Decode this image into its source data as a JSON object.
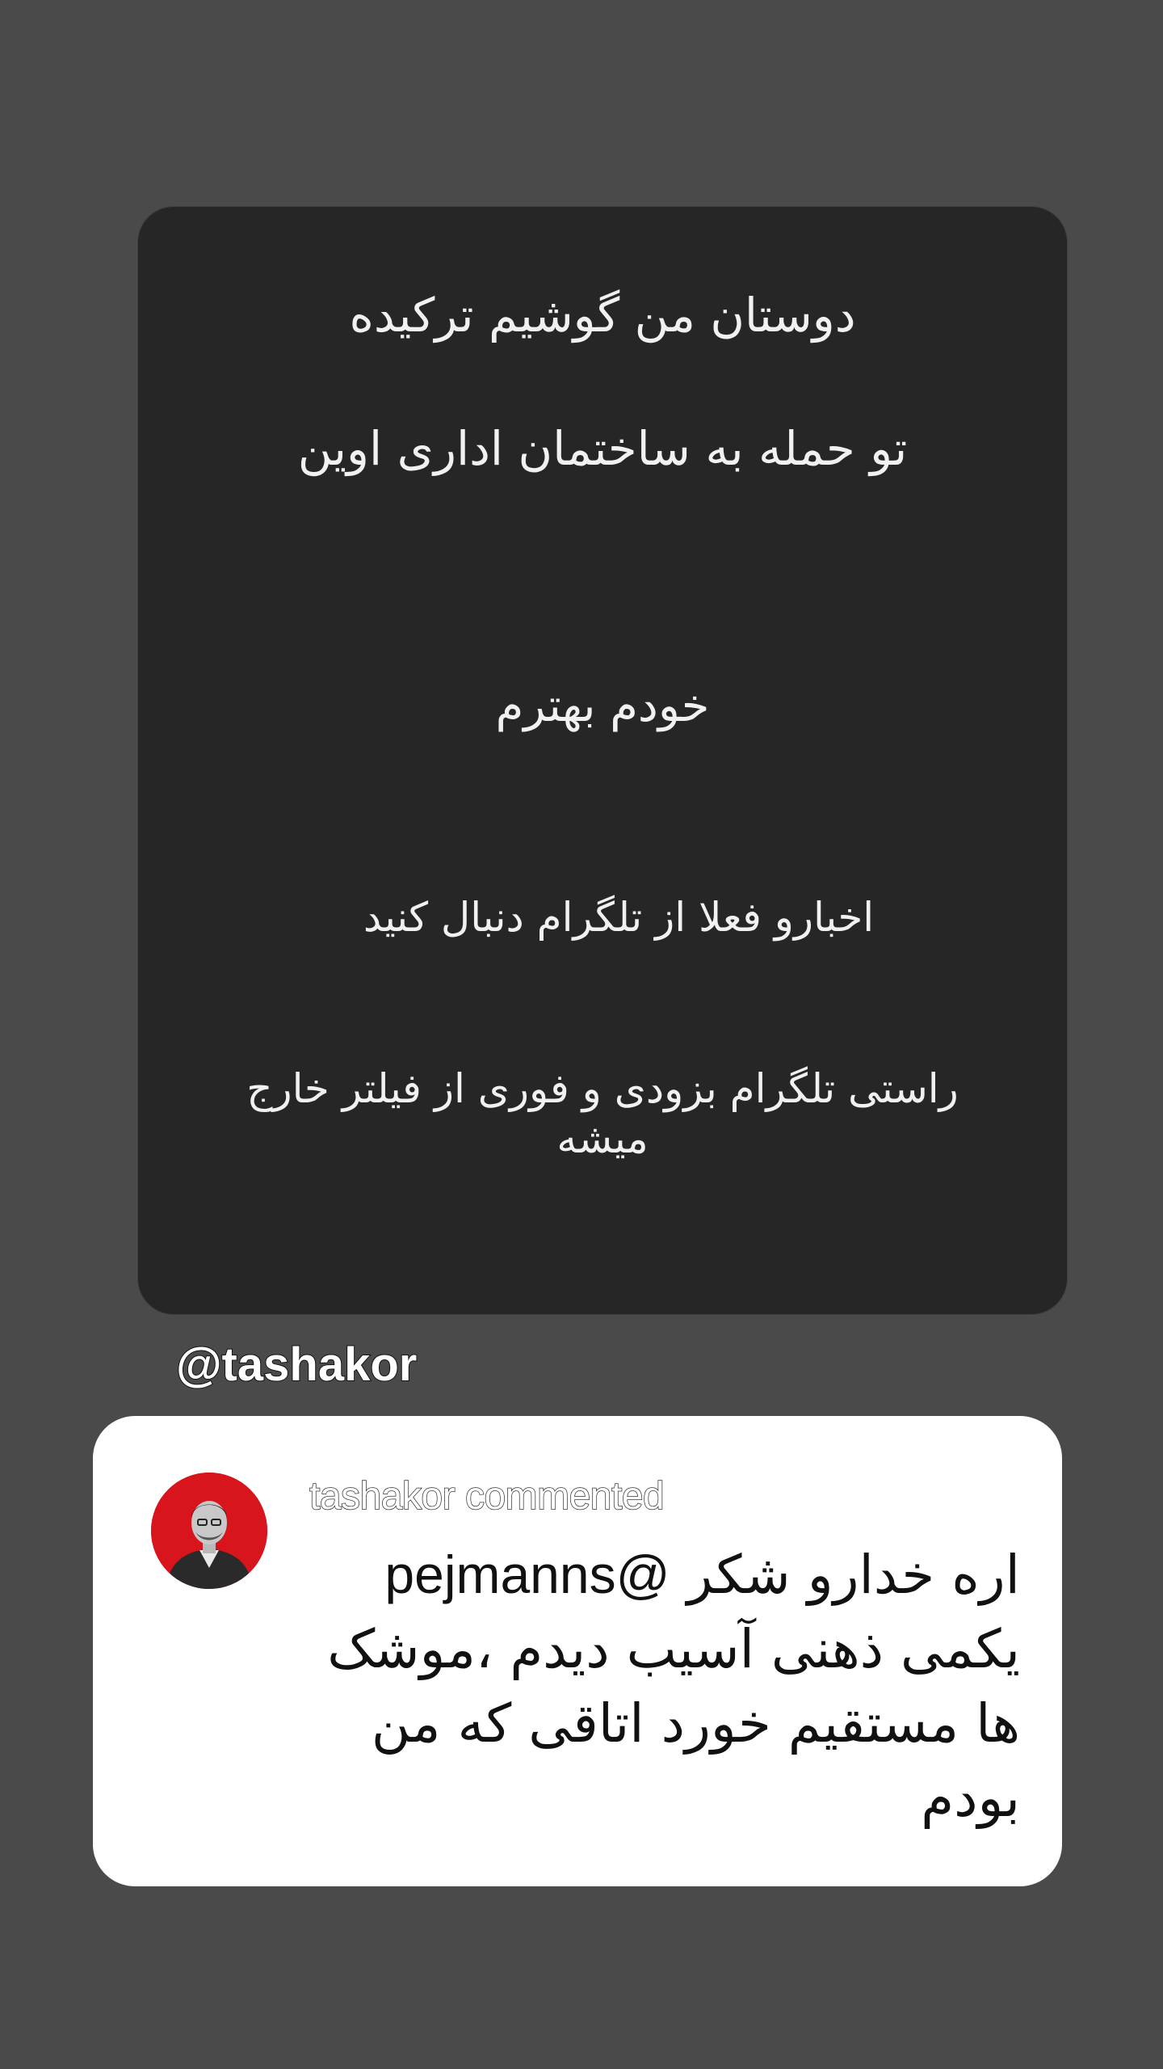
{
  "story": {
    "line1": "دوستان من گوشیم ترکیده",
    "line2": "تو حمله به ساختمان اداری اوین",
    "line3": "خودم بهترم",
    "line4": "اخبارو  فعلا از تلگرام دنبال کنید",
    "line5": "راستی تلگرام بزودی و فوری از فیلتر خارج میشه"
  },
  "mention": "@tashakor",
  "comment": {
    "author_line": "tashakor commented",
    "handle": "@pejmanns",
    "text": "اره خدارو شکر",
    "text_rest": "یکمی ذهنی آسیب دیدم ،موشک ها مستقیم خورد اتاقی که من بودم",
    "avatar_bg": "#d8141c"
  }
}
